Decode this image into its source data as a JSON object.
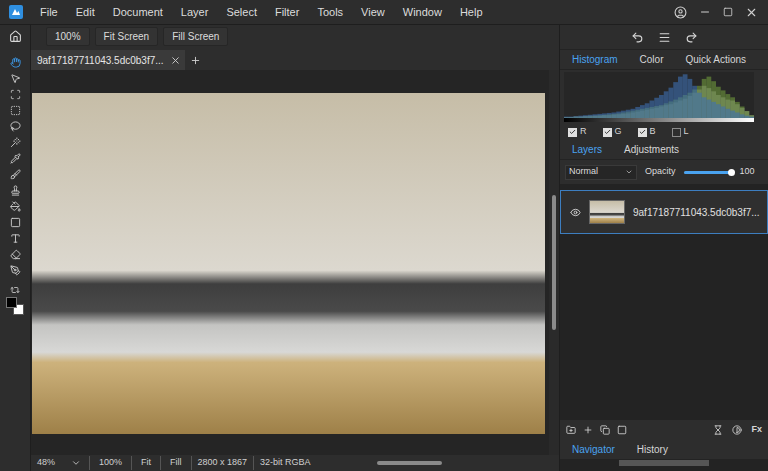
{
  "menu": [
    "File",
    "Edit",
    "Document",
    "Layer",
    "Select",
    "Filter",
    "Tools",
    "View",
    "Window",
    "Help"
  ],
  "view_buttons": [
    "100%",
    "Fit Screen",
    "Fill Screen"
  ],
  "document_tabs": [
    {
      "label": "9af17187711043.5dc0b3f7...",
      "selected": true
    }
  ],
  "tools": [
    {
      "selected": true
    },
    {
      "selected": false
    },
    {
      "selected": false
    },
    {
      "selected": false
    },
    {
      "selected": false
    },
    {
      "selected": false
    },
    {
      "selected": false
    },
    {
      "selected": false
    },
    {
      "selected": false
    },
    {
      "selected": false
    },
    {
      "selected": false
    },
    {
      "selected": false
    },
    {
      "selected": false
    },
    {
      "selected": false
    }
  ],
  "colors": {
    "foreground": "#000000",
    "background": "#ffffff"
  },
  "status_bar": {
    "zoom": "48%",
    "buttons": [
      "100%",
      "Fit",
      "Fill"
    ],
    "size": "2800 x 1867",
    "mode": "32-bit RGBA"
  },
  "info_tabs": [
    {
      "label": "Histogram",
      "selected": true
    },
    {
      "label": "Color",
      "selected": false
    },
    {
      "label": "Quick Actions",
      "selected": false
    }
  ],
  "histogram": {
    "series": [
      {
        "color": "#9a9a9a",
        "values": [
          2,
          2,
          3,
          3,
          4,
          4,
          5,
          5,
          6,
          6,
          7,
          8,
          9,
          10,
          12,
          14,
          16,
          18,
          20,
          22,
          25,
          28,
          30,
          34,
          38,
          42,
          48,
          55,
          62,
          70,
          65,
          58,
          50,
          45,
          40,
          38,
          30,
          22,
          15,
          6
        ]
      },
      {
        "color": "#6f9a3c",
        "values": [
          2,
          2,
          3,
          3,
          4,
          5,
          5,
          6,
          7,
          8,
          9,
          10,
          12,
          14,
          16,
          18,
          20,
          22,
          24,
          26,
          28,
          32,
          36,
          40,
          45,
          50,
          55,
          62,
          70,
          85,
          90,
          80,
          68,
          60,
          52,
          45,
          35,
          25,
          15,
          6
        ]
      },
      {
        "color": "#3d6fb3",
        "values": [
          3,
          3,
          4,
          5,
          6,
          7,
          8,
          9,
          10,
          11,
          12,
          14,
          16,
          18,
          20,
          24,
          28,
          32,
          38,
          44,
          50,
          58,
          66,
          78,
          90,
          95,
          85,
          70,
          55,
          45,
          40,
          35,
          30,
          25,
          20,
          16,
          12,
          8,
          5,
          3
        ]
      }
    ]
  },
  "channels": [
    {
      "label": "R",
      "checked": true
    },
    {
      "label": "G",
      "checked": true
    },
    {
      "label": "B",
      "checked": true
    },
    {
      "label": "L",
      "checked": false
    }
  ],
  "layer_tabs": [
    {
      "label": "Layers",
      "selected": true
    },
    {
      "label": "Adjustments",
      "selected": false
    }
  ],
  "blend_mode": "Normal",
  "opacity": {
    "label": "Opacity",
    "level": 1,
    "reading": "100"
  },
  "layers": [
    {
      "name": "9af17187711043.5dc0b3f7...",
      "visible": true,
      "selected": true
    }
  ],
  "fx_button": "Fx",
  "bottom_tabs": [
    {
      "label": "Navigator",
      "selected": true
    },
    {
      "label": "History",
      "selected": false
    }
  ]
}
